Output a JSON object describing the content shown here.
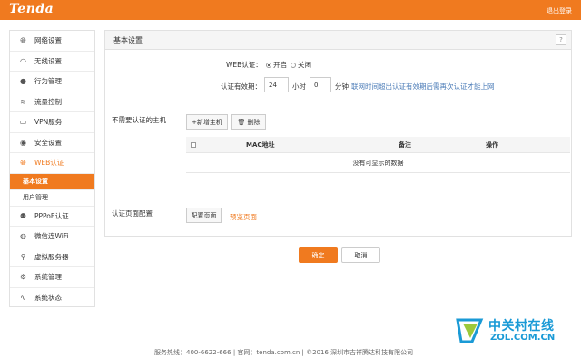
{
  "header": {
    "logo": "Tenda",
    "logout": "退出登录"
  },
  "colors": {
    "accent": "#f07a1f",
    "watermark": "#1a9ad6"
  },
  "sidebar": {
    "items": [
      {
        "label": "网络设置",
        "icon": "globe-icon"
      },
      {
        "label": "无线设置",
        "icon": "wifi-icon"
      },
      {
        "label": "行为管理",
        "icon": "user-icon"
      },
      {
        "label": "流量控制",
        "icon": "traffic-icon"
      },
      {
        "label": "VPN服务",
        "icon": "monitor-icon"
      },
      {
        "label": "安全设置",
        "icon": "shield-icon"
      },
      {
        "label": "WEB认证",
        "icon": "globe-icon"
      },
      {
        "label": "PPPoE认证",
        "icon": "group-icon"
      },
      {
        "label": "微信连WiFi",
        "icon": "wechat-icon"
      },
      {
        "label": "虚拟服务器",
        "icon": "server-icon"
      },
      {
        "label": "系统管理",
        "icon": "gear-icon"
      },
      {
        "label": "系统状态",
        "icon": "pulse-icon"
      }
    ],
    "sub_items": [
      {
        "label": "基本设置",
        "selected": true
      },
      {
        "label": "用户管理",
        "selected": false
      }
    ]
  },
  "panel": {
    "title": "基本设置",
    "help": "?",
    "web_auth": {
      "label": "WEB认证：",
      "on": "开启",
      "off": "关闭",
      "selected": "开启"
    },
    "validity": {
      "label": "认证有效期：",
      "hours_value": "24",
      "hours_unit": "小时",
      "minutes_value": "0",
      "minutes_unit": "分钟",
      "note": "联网时间超出认证有效期后需再次认证才能上网"
    },
    "exempt": {
      "label": "不需要认证的主机",
      "add_button": "+新增主机",
      "delete_button": "删除"
    },
    "table": {
      "headers": [
        "MAC地址",
        "备注",
        "操作"
      ],
      "empty": "没有可显示的数据"
    },
    "auth_page": {
      "label": "认证页面配置",
      "config_button": "配置页面",
      "preview_link": "预览页面"
    }
  },
  "actions": {
    "ok": "确定",
    "cancel": "取消"
  },
  "footer": {
    "text": "服务热线：400-6622-666  |  官网：tenda.com.cn  |  ©2016 深圳市吉祥腾达科技有限公司"
  },
  "watermark": {
    "cn": "中关村在线",
    "en": "ZOL.COM.CN"
  }
}
